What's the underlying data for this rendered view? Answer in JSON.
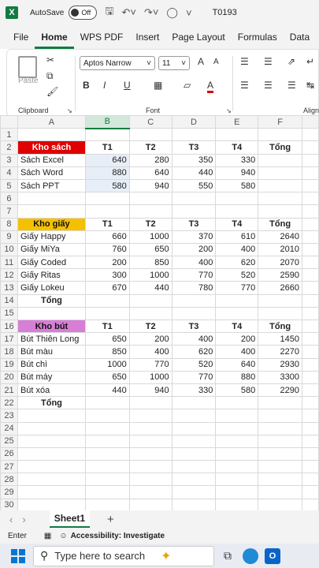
{
  "titlebar": {
    "logo": "X",
    "autosave_label": "AutoSave",
    "autosave_state": "Off",
    "doc_name": "T0193"
  },
  "tabs": [
    "File",
    "Home",
    "WPS PDF",
    "Insert",
    "Page Layout",
    "Formulas",
    "Data"
  ],
  "ribbon": {
    "paste": "Paste",
    "clipboard": "Clipboard",
    "font_name": "Aptos Narrow",
    "font_size": "11",
    "font_group": "Font",
    "align_group": "Align",
    "bold": "B",
    "italic": "I",
    "underline": "U",
    "font_color": "A",
    "grow": "A",
    "shrink": "A"
  },
  "columns": [
    "A",
    "B",
    "C",
    "D",
    "E",
    "F"
  ],
  "rows": [
    {
      "n": "1",
      "c": [
        "",
        "",
        "",
        "",
        "",
        ""
      ]
    },
    {
      "n": "2",
      "c": [
        "Kho sách",
        "T1",
        "T2",
        "T3",
        "T4",
        "Tổng"
      ]
    },
    {
      "n": "3",
      "c": [
        "Sách Excel",
        "640",
        "280",
        "350",
        "330",
        ""
      ]
    },
    {
      "n": "4",
      "c": [
        "Sách Word",
        "880",
        "640",
        "440",
        "940",
        ""
      ]
    },
    {
      "n": "5",
      "c": [
        "Sách PPT",
        "580",
        "940",
        "550",
        "580",
        ""
      ]
    },
    {
      "n": "6",
      "c": [
        "",
        "",
        "",
        "",
        "",
        ""
      ]
    },
    {
      "n": "7",
      "c": [
        "",
        "",
        "",
        "",
        "",
        ""
      ]
    },
    {
      "n": "8",
      "c": [
        "Kho giấy",
        "T1",
        "T2",
        "T3",
        "T4",
        "Tổng"
      ]
    },
    {
      "n": "9",
      "c": [
        "Giấy Happy",
        "660",
        "1000",
        "370",
        "610",
        "2640"
      ]
    },
    {
      "n": "10",
      "c": [
        "Giấy MiYa",
        "760",
        "650",
        "200",
        "400",
        "2010"
      ]
    },
    {
      "n": "11",
      "c": [
        "Giấy Coded",
        "200",
        "850",
        "400",
        "620",
        "2070"
      ]
    },
    {
      "n": "12",
      "c": [
        "Giấy Ritas",
        "300",
        "1000",
        "770",
        "520",
        "2590"
      ]
    },
    {
      "n": "13",
      "c": [
        "Giấy Lokeu",
        "670",
        "440",
        "780",
        "770",
        "2660"
      ]
    },
    {
      "n": "14",
      "c": [
        "Tổng",
        "",
        "",
        "",
        "",
        ""
      ]
    },
    {
      "n": "15",
      "c": [
        "",
        "",
        "",
        "",
        "",
        ""
      ]
    },
    {
      "n": "16",
      "c": [
        "Kho bút",
        "T1",
        "T2",
        "T3",
        "T4",
        "Tổng"
      ]
    },
    {
      "n": "17",
      "c": [
        "Bút Thiên Long",
        "650",
        "200",
        "400",
        "200",
        "1450"
      ]
    },
    {
      "n": "18",
      "c": [
        "Bút màu",
        "850",
        "400",
        "620",
        "400",
        "2270"
      ]
    },
    {
      "n": "19",
      "c": [
        "Bút chì",
        "1000",
        "770",
        "520",
        "640",
        "2930"
      ]
    },
    {
      "n": "20",
      "c": [
        "Bút máy",
        "650",
        "1000",
        "770",
        "880",
        "3300"
      ]
    },
    {
      "n": "21",
      "c": [
        "Bút xóa",
        "440",
        "940",
        "330",
        "580",
        "2290"
      ]
    },
    {
      "n": "22",
      "c": [
        "Tổng",
        "",
        "",
        "",
        "",
        ""
      ]
    },
    {
      "n": "23",
      "c": [
        "",
        "",
        "",
        "",
        "",
        ""
      ]
    },
    {
      "n": "24",
      "c": [
        "",
        "",
        "",
        "",
        "",
        ""
      ]
    },
    {
      "n": "25",
      "c": [
        "",
        "",
        "",
        "",
        "",
        ""
      ]
    },
    {
      "n": "26",
      "c": [
        "",
        "",
        "",
        "",
        "",
        ""
      ]
    },
    {
      "n": "27",
      "c": [
        "",
        "",
        "",
        "",
        "",
        ""
      ]
    },
    {
      "n": "28",
      "c": [
        "",
        "",
        "",
        "",
        "",
        ""
      ]
    },
    {
      "n": "29",
      "c": [
        "",
        "",
        "",
        "",
        "",
        ""
      ]
    },
    {
      "n": "30",
      "c": [
        "",
        "",
        "",
        "",
        "",
        ""
      ]
    }
  ],
  "colors": {
    "kho_sach": "#e00000",
    "kho_giay": "#f5c000",
    "kho_but": "#d77fd6",
    "excel_green": "#107c41"
  },
  "sheet_tab": "Sheet1",
  "status": {
    "mode": "Enter",
    "accessibility": "Accessibility: Investigate"
  },
  "taskbar": {
    "search_placeholder": "Type here to search"
  }
}
